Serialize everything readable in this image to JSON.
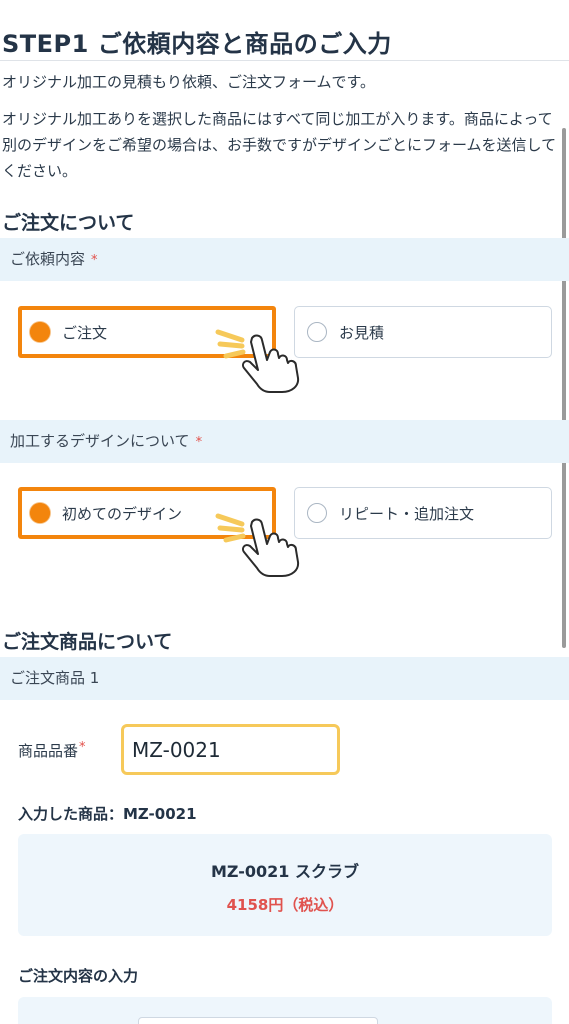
{
  "header": {
    "title": "STEP1 ご依頼内容と商品のご入力"
  },
  "intro": {
    "line1": "オリジナル加工の見積もり依頼、ご注文フォームです。",
    "line2": "オリジナル加工ありを選択した商品にはすべて同じ加工が入ります。商品によって別のデザインをご希望の場合は、お手数ですがデザインごとにフォームを送信してください。"
  },
  "order_section": {
    "heading": "ご注文について",
    "request_type": {
      "label": "ご依頼内容",
      "required_mark": "*",
      "options": [
        "ご注文",
        "お見積"
      ],
      "selected": "ご注文"
    },
    "design_type": {
      "label": "加工するデザインについて",
      "required_mark": "*",
      "options": [
        "初めてのデザイン",
        "リピート・追加注文"
      ],
      "selected": "初めてのデザイン"
    }
  },
  "product_section": {
    "heading": "ご注文商品について",
    "item_label": "ご注文商品 1",
    "code_field": {
      "label": "商品品番",
      "required_mark": "*",
      "value": "MZ-0021"
    },
    "entered_label": "入力した商品：MZ-0021",
    "product": {
      "name": "MZ-0021 スクラブ",
      "price": "4158円（税込）"
    },
    "order_input_heading": "ご注文内容の入力"
  },
  "colors": {
    "accent": "#f3850d",
    "band": "#e8f3fa",
    "input_highlight": "#f6c95a",
    "price": "#e0524e",
    "required": "#e2504a"
  },
  "icons": {
    "pointer": "pointing-hand-icon",
    "radio_on": "radio-selected-icon",
    "radio_off": "radio-unselected-icon"
  }
}
